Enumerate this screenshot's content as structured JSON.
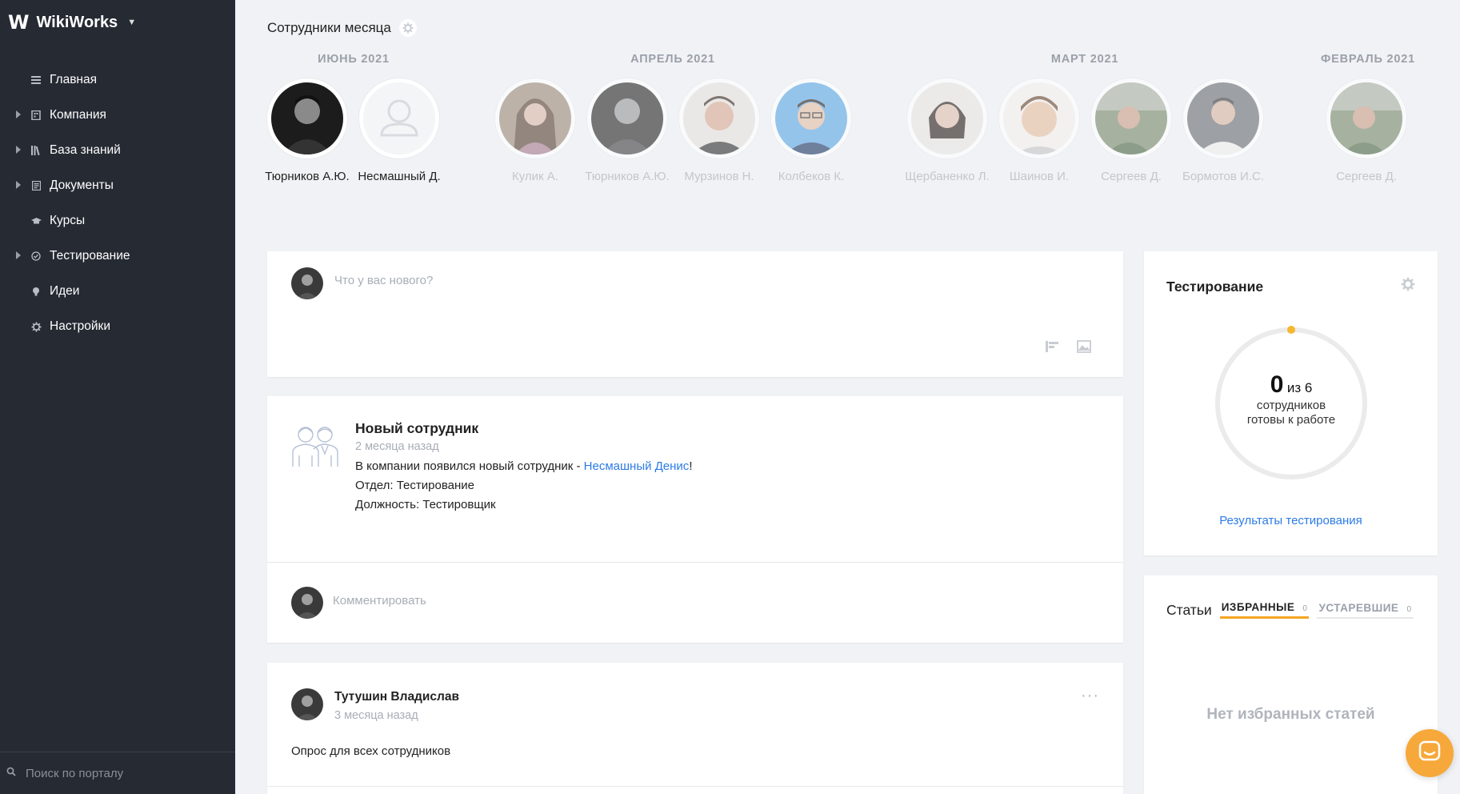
{
  "brand": {
    "logo": "W",
    "name": "WikiWorks"
  },
  "sidebar": {
    "items": [
      {
        "label": "Главная",
        "icon": "menu-icon",
        "expandable": false
      },
      {
        "label": "Компания",
        "icon": "building-icon",
        "expandable": true
      },
      {
        "label": "База знаний",
        "icon": "library-icon",
        "expandable": true
      },
      {
        "label": "Документы",
        "icon": "document-icon",
        "expandable": true
      },
      {
        "label": "Курсы",
        "icon": "graduation-cap-icon",
        "expandable": false
      },
      {
        "label": "Тестирование",
        "icon": "check-circle-icon",
        "expandable": true
      },
      {
        "label": "Идеи",
        "icon": "lightbulb-icon",
        "expandable": false
      },
      {
        "label": "Настройки",
        "icon": "gear-icon",
        "expandable": false
      }
    ],
    "search_placeholder": "Поиск по порталу"
  },
  "employees_of_month": {
    "title": "Сотрудники месяца",
    "months": [
      {
        "label": "Июнь 2021",
        "people": [
          {
            "name": "Тюрников А.Ю.",
            "photo": "photo-dark",
            "active": true
          },
          {
            "name": "Несмашный Д.",
            "photo": "placeholder",
            "active": true
          }
        ]
      },
      {
        "label": "Апрель 2021",
        "people": [
          {
            "name": "Кулик А.",
            "photo": "photo-woman",
            "active": false
          },
          {
            "name": "Тюрников А.Ю.",
            "photo": "photo-dark",
            "active": false
          },
          {
            "name": "Мурзинов Н.",
            "photo": "photo-man",
            "active": false
          },
          {
            "name": "Колбеков К.",
            "photo": "photo-blue",
            "active": false
          }
        ]
      },
      {
        "label": "Март 2021",
        "people": [
          {
            "name": "Щербаненко Л.",
            "photo": "photo-woman2",
            "active": false
          },
          {
            "name": "Шаинов И.",
            "photo": "photo-man2",
            "active": false
          },
          {
            "name": "Сергеев Д.",
            "photo": "photo-outdoor",
            "active": false
          },
          {
            "name": "Бормотов И.С.",
            "photo": "photo-man3",
            "active": false
          }
        ]
      },
      {
        "label": "Февраль 2021",
        "people": [
          {
            "name": "Сергеев Д.",
            "photo": "photo-outdoor",
            "active": false
          }
        ]
      }
    ]
  },
  "composer": {
    "placeholder": "Что у вас нового?",
    "tools": [
      "poll-icon",
      "image-icon"
    ]
  },
  "news_card": {
    "title": "Новый сотрудник",
    "time": "2 месяца назад",
    "text_prefix": "В компании появился новый сотрудник - ",
    "link": "Несмашный Денис",
    "text_suffix": "!",
    "department": "Отдел: Тестирование",
    "position": "Должность: Тестировщик",
    "comment_placeholder": "Комментировать"
  },
  "post": {
    "author": "Тутушин Владислав",
    "time": "3 месяца назад",
    "more": "···",
    "body": "Опрос для всех сотрудников"
  },
  "testing_widget": {
    "title": "Тестирование",
    "count": "0",
    "of_text": "из 6",
    "sub_line1": "сотрудников",
    "sub_line2": "готовы к работе",
    "progress": 0,
    "link": "Результаты тестирования",
    "colors": {
      "ring": "#ebebeb",
      "dot": "#f5b82e"
    }
  },
  "articles_widget": {
    "title": "Статьи",
    "tabs": [
      {
        "label": "ИЗБРАННЫЕ",
        "count": "0",
        "active": true
      },
      {
        "label": "УСТАРЕВШИЕ",
        "count": "0",
        "active": false
      }
    ],
    "empty_text": "Нет избранных статей"
  },
  "colors": {
    "sidebar": "#252a33",
    "background": "#f1f2f5",
    "link": "#2c7be5",
    "accent": "#f5a623"
  }
}
